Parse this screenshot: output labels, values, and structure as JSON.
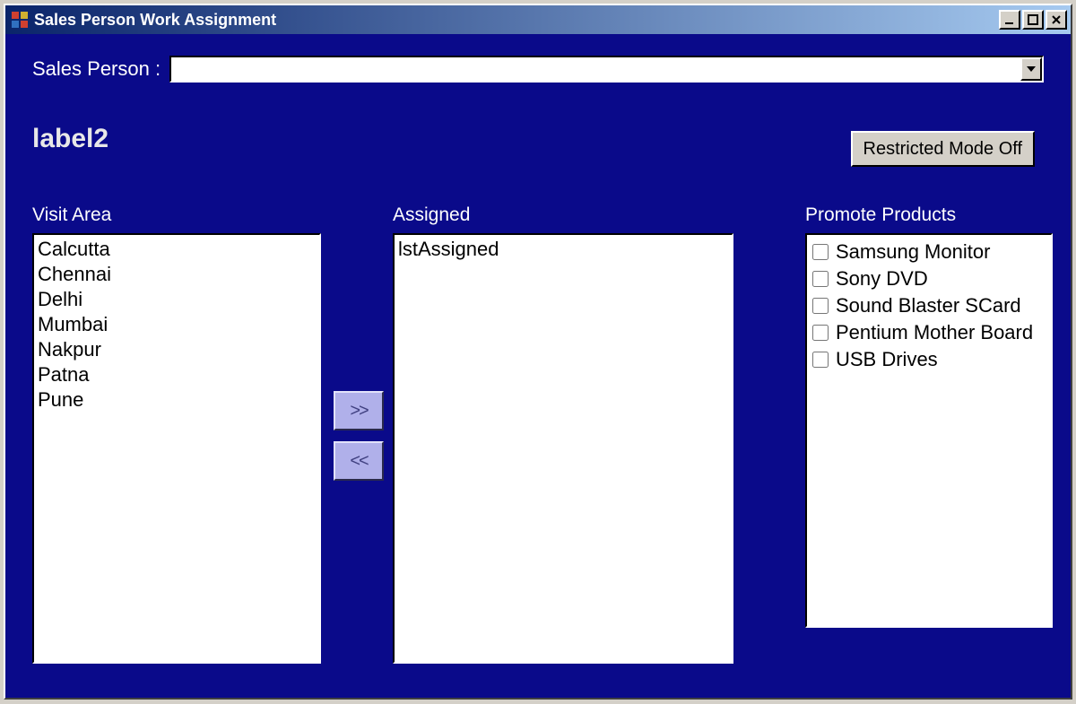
{
  "window": {
    "title": "Sales Person Work Assignment"
  },
  "labels": {
    "sales_person": "Sales Person :",
    "label2": "label2",
    "visit_area": "Visit Area",
    "assigned": "Assigned",
    "promote_products": "Promote Products"
  },
  "buttons": {
    "restricted_mode": "Restricted Mode Off",
    "move_right": ">>",
    "move_left": "<<"
  },
  "sales_person_combo": {
    "value": ""
  },
  "visit_area_items": [
    "Calcutta",
    "Chennai",
    "Delhi",
    "Mumbai",
    "Nakpur",
    "Patna",
    "Pune"
  ],
  "assigned_items": [
    "lstAssigned"
  ],
  "promote_products_items": [
    {
      "label": "Samsung Monitor",
      "checked": false
    },
    {
      "label": "Sony DVD",
      "checked": false
    },
    {
      "label": "Sound Blaster SCard",
      "checked": false
    },
    {
      "label": "Pentium Mother Board",
      "checked": false
    },
    {
      "label": "USB Drives",
      "checked": false
    }
  ]
}
